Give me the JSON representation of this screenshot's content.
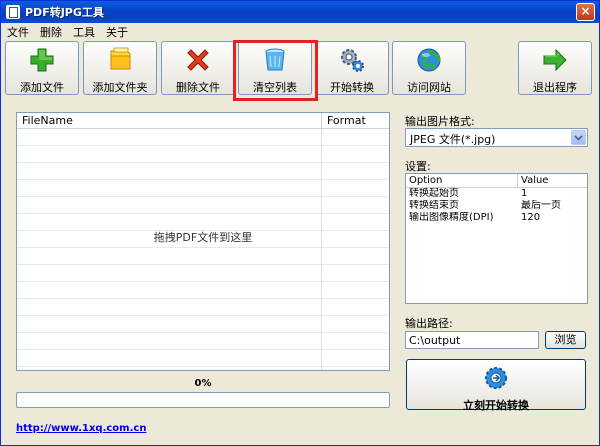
{
  "window": {
    "title": "PDF转JPG工具",
    "close_label": "×"
  },
  "menu": [
    "文件",
    "删除",
    "工具",
    "关于"
  ],
  "toolbar": {
    "add_file": "添加文件",
    "add_folder": "添加文件夹",
    "delete_file": "删除文件",
    "clear_list": "清空列表",
    "start_convert": "开始转换",
    "visit_site": "访问网站",
    "exit_program": "退出程序"
  },
  "file_list": {
    "col_filename": "FileName",
    "col_format": "Format",
    "drop_hint": "拖拽PDF文件到这里"
  },
  "progress": {
    "label": "0%",
    "value": 0.0
  },
  "link": "http://www.1xq.com.cn",
  "output_format": {
    "label": "输出图片格式:",
    "selected": "JPEG 文件(*.jpg)"
  },
  "settings": {
    "label": "设置:",
    "col_option": "Option",
    "col_value": "Value",
    "rows": [
      {
        "option": "转换起始页",
        "value": "1"
      },
      {
        "option": "转换结束页",
        "value": "最后一页"
      },
      {
        "option": "输出图像精度(DPI)",
        "value": "120"
      }
    ]
  },
  "output_path": {
    "label": "输出路径:",
    "value": "C:\\output",
    "browse": "浏览"
  },
  "start_button": {
    "label": "立刻开始转换"
  },
  "colors": {
    "title_bar": "#0a4fd0",
    "highlight": "#e32323",
    "window_bg": "#ece9d8"
  }
}
